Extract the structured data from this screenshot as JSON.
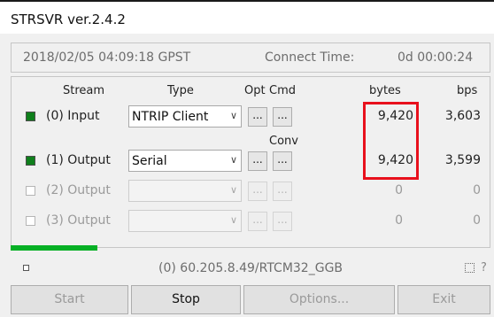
{
  "window": {
    "title": "STRSVR ver.2.4.2"
  },
  "status": {
    "datetime": "2018/02/05 04:09:18 GPST",
    "connect_label": "Connect Time:",
    "connect_value": "0d 00:00:24"
  },
  "headers": {
    "stream": "Stream",
    "type": "Type",
    "opt": "Opt",
    "cmd": "Cmd",
    "conv": "Conv",
    "bytes": "bytes",
    "bps": "bps"
  },
  "streams": [
    {
      "label": "(0) Input",
      "type": "NTRIP Client",
      "bytes": "9,420",
      "bps": "3,603",
      "active": true,
      "opt_label": "...",
      "cmd_label": "..."
    },
    {
      "label": "(1) Output",
      "type": "Serial",
      "bytes": "9,420",
      "bps": "3,599",
      "active": true,
      "opt_label": "...",
      "cmd_label": "..."
    },
    {
      "label": "(2) Output",
      "type": "",
      "bytes": "0",
      "bps": "0",
      "active": false,
      "opt_label": "...",
      "cmd_label": "..."
    },
    {
      "label": "(3) Output",
      "type": "",
      "bytes": "0",
      "bps": "0",
      "active": false,
      "opt_label": "...",
      "cmd_label": "..."
    }
  ],
  "progress": 0.18,
  "footer": {
    "source": "(0) 60.205.8.49/RTCM32_GGB",
    "help": "?"
  },
  "buttons": {
    "start": "Start",
    "stop": "Stop",
    "options": "Options...",
    "exit": "Exit"
  },
  "colors": {
    "led_on": "#0f7f1c",
    "highlight": "#e8101c",
    "progress": "#06b025"
  }
}
